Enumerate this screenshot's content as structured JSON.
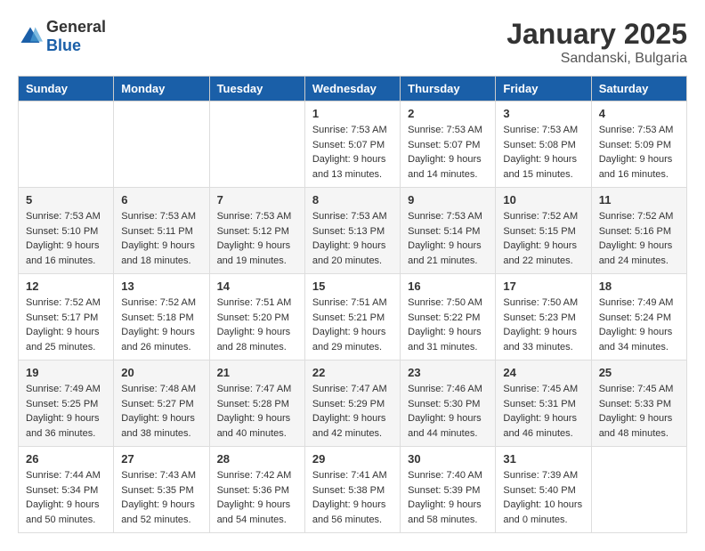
{
  "header": {
    "logo_general": "General",
    "logo_blue": "Blue",
    "month": "January 2025",
    "location": "Sandanski, Bulgaria"
  },
  "weekdays": [
    "Sunday",
    "Monday",
    "Tuesday",
    "Wednesday",
    "Thursday",
    "Friday",
    "Saturday"
  ],
  "weeks": [
    [
      {
        "day": "",
        "sunrise": "",
        "sunset": "",
        "daylight": ""
      },
      {
        "day": "",
        "sunrise": "",
        "sunset": "",
        "daylight": ""
      },
      {
        "day": "",
        "sunrise": "",
        "sunset": "",
        "daylight": ""
      },
      {
        "day": "1",
        "sunrise": "Sunrise: 7:53 AM",
        "sunset": "Sunset: 5:07 PM",
        "daylight": "Daylight: 9 hours and 13 minutes."
      },
      {
        "day": "2",
        "sunrise": "Sunrise: 7:53 AM",
        "sunset": "Sunset: 5:07 PM",
        "daylight": "Daylight: 9 hours and 14 minutes."
      },
      {
        "day": "3",
        "sunrise": "Sunrise: 7:53 AM",
        "sunset": "Sunset: 5:08 PM",
        "daylight": "Daylight: 9 hours and 15 minutes."
      },
      {
        "day": "4",
        "sunrise": "Sunrise: 7:53 AM",
        "sunset": "Sunset: 5:09 PM",
        "daylight": "Daylight: 9 hours and 16 minutes."
      }
    ],
    [
      {
        "day": "5",
        "sunrise": "Sunrise: 7:53 AM",
        "sunset": "Sunset: 5:10 PM",
        "daylight": "Daylight: 9 hours and 16 minutes."
      },
      {
        "day": "6",
        "sunrise": "Sunrise: 7:53 AM",
        "sunset": "Sunset: 5:11 PM",
        "daylight": "Daylight: 9 hours and 18 minutes."
      },
      {
        "day": "7",
        "sunrise": "Sunrise: 7:53 AM",
        "sunset": "Sunset: 5:12 PM",
        "daylight": "Daylight: 9 hours and 19 minutes."
      },
      {
        "day": "8",
        "sunrise": "Sunrise: 7:53 AM",
        "sunset": "Sunset: 5:13 PM",
        "daylight": "Daylight: 9 hours and 20 minutes."
      },
      {
        "day": "9",
        "sunrise": "Sunrise: 7:53 AM",
        "sunset": "Sunset: 5:14 PM",
        "daylight": "Daylight: 9 hours and 21 minutes."
      },
      {
        "day": "10",
        "sunrise": "Sunrise: 7:52 AM",
        "sunset": "Sunset: 5:15 PM",
        "daylight": "Daylight: 9 hours and 22 minutes."
      },
      {
        "day": "11",
        "sunrise": "Sunrise: 7:52 AM",
        "sunset": "Sunset: 5:16 PM",
        "daylight": "Daylight: 9 hours and 24 minutes."
      }
    ],
    [
      {
        "day": "12",
        "sunrise": "Sunrise: 7:52 AM",
        "sunset": "Sunset: 5:17 PM",
        "daylight": "Daylight: 9 hours and 25 minutes."
      },
      {
        "day": "13",
        "sunrise": "Sunrise: 7:52 AM",
        "sunset": "Sunset: 5:18 PM",
        "daylight": "Daylight: 9 hours and 26 minutes."
      },
      {
        "day": "14",
        "sunrise": "Sunrise: 7:51 AM",
        "sunset": "Sunset: 5:20 PM",
        "daylight": "Daylight: 9 hours and 28 minutes."
      },
      {
        "day": "15",
        "sunrise": "Sunrise: 7:51 AM",
        "sunset": "Sunset: 5:21 PM",
        "daylight": "Daylight: 9 hours and 29 minutes."
      },
      {
        "day": "16",
        "sunrise": "Sunrise: 7:50 AM",
        "sunset": "Sunset: 5:22 PM",
        "daylight": "Daylight: 9 hours and 31 minutes."
      },
      {
        "day": "17",
        "sunrise": "Sunrise: 7:50 AM",
        "sunset": "Sunset: 5:23 PM",
        "daylight": "Daylight: 9 hours and 33 minutes."
      },
      {
        "day": "18",
        "sunrise": "Sunrise: 7:49 AM",
        "sunset": "Sunset: 5:24 PM",
        "daylight": "Daylight: 9 hours and 34 minutes."
      }
    ],
    [
      {
        "day": "19",
        "sunrise": "Sunrise: 7:49 AM",
        "sunset": "Sunset: 5:25 PM",
        "daylight": "Daylight: 9 hours and 36 minutes."
      },
      {
        "day": "20",
        "sunrise": "Sunrise: 7:48 AM",
        "sunset": "Sunset: 5:27 PM",
        "daylight": "Daylight: 9 hours and 38 minutes."
      },
      {
        "day": "21",
        "sunrise": "Sunrise: 7:47 AM",
        "sunset": "Sunset: 5:28 PM",
        "daylight": "Daylight: 9 hours and 40 minutes."
      },
      {
        "day": "22",
        "sunrise": "Sunrise: 7:47 AM",
        "sunset": "Sunset: 5:29 PM",
        "daylight": "Daylight: 9 hours and 42 minutes."
      },
      {
        "day": "23",
        "sunrise": "Sunrise: 7:46 AM",
        "sunset": "Sunset: 5:30 PM",
        "daylight": "Daylight: 9 hours and 44 minutes."
      },
      {
        "day": "24",
        "sunrise": "Sunrise: 7:45 AM",
        "sunset": "Sunset: 5:31 PM",
        "daylight": "Daylight: 9 hours and 46 minutes."
      },
      {
        "day": "25",
        "sunrise": "Sunrise: 7:45 AM",
        "sunset": "Sunset: 5:33 PM",
        "daylight": "Daylight: 9 hours and 48 minutes."
      }
    ],
    [
      {
        "day": "26",
        "sunrise": "Sunrise: 7:44 AM",
        "sunset": "Sunset: 5:34 PM",
        "daylight": "Daylight: 9 hours and 50 minutes."
      },
      {
        "day": "27",
        "sunrise": "Sunrise: 7:43 AM",
        "sunset": "Sunset: 5:35 PM",
        "daylight": "Daylight: 9 hours and 52 minutes."
      },
      {
        "day": "28",
        "sunrise": "Sunrise: 7:42 AM",
        "sunset": "Sunset: 5:36 PM",
        "daylight": "Daylight: 9 hours and 54 minutes."
      },
      {
        "day": "29",
        "sunrise": "Sunrise: 7:41 AM",
        "sunset": "Sunset: 5:38 PM",
        "daylight": "Daylight: 9 hours and 56 minutes."
      },
      {
        "day": "30",
        "sunrise": "Sunrise: 7:40 AM",
        "sunset": "Sunset: 5:39 PM",
        "daylight": "Daylight: 9 hours and 58 minutes."
      },
      {
        "day": "31",
        "sunrise": "Sunrise: 7:39 AM",
        "sunset": "Sunset: 5:40 PM",
        "daylight": "Daylight: 10 hours and 0 minutes."
      },
      {
        "day": "",
        "sunrise": "",
        "sunset": "",
        "daylight": ""
      }
    ]
  ]
}
